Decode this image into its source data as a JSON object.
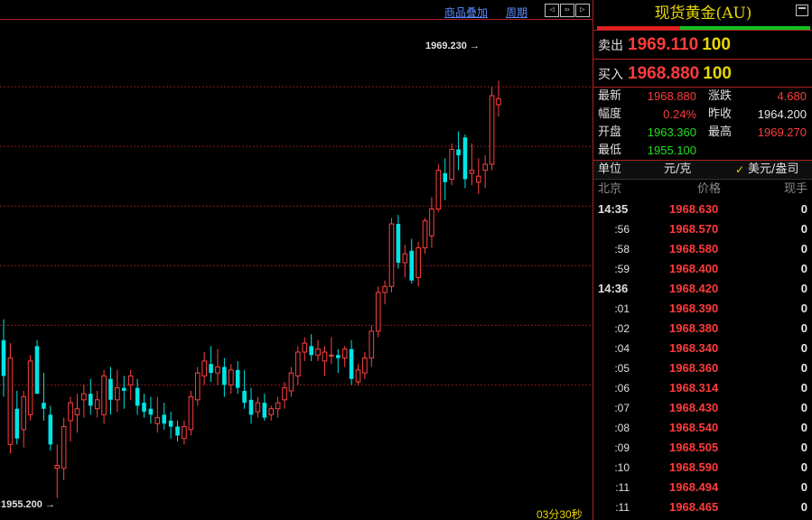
{
  "toolbar": {
    "overlay_link": "商品叠加",
    "period_link": "周期"
  },
  "chart": {
    "high_label": "1969.230",
    "low_label": "1955.200",
    "timer": "03分30秒",
    "colors": {
      "up": "#ff4040",
      "down": "#00e5e5",
      "grid": "#8a1a1a",
      "border": "#b02020"
    }
  },
  "chart_data": {
    "type": "candlestick",
    "ylim": [
      1954.8,
      1970.7
    ],
    "grid_y": [
      1969.0,
      1967.0,
      1965.0,
      1963.0,
      1961.0,
      1959.0
    ],
    "candles": [
      {
        "o": 1960.5,
        "h": 1961.2,
        "l": 1958.6,
        "c": 1959.3
      },
      {
        "o": 1957.0,
        "h": 1960.4,
        "l": 1956.7,
        "c": 1959.9
      },
      {
        "o": 1958.2,
        "h": 1958.8,
        "l": 1957.0,
        "c": 1957.2
      },
      {
        "o": 1957.5,
        "h": 1958.8,
        "l": 1956.9,
        "c": 1958.6
      },
      {
        "o": 1958.0,
        "h": 1960.0,
        "l": 1957.8,
        "c": 1959.8
      },
      {
        "o": 1960.3,
        "h": 1960.5,
        "l": 1958.7,
        "c": 1958.7
      },
      {
        "o": 1958.4,
        "h": 1959.4,
        "l": 1957.8,
        "c": 1958.2
      },
      {
        "o": 1958.0,
        "h": 1958.3,
        "l": 1956.8,
        "c": 1957.0
      },
      {
        "o": 1956.2,
        "h": 1957.0,
        "l": 1955.2,
        "c": 1956.3
      },
      {
        "o": 1956.2,
        "h": 1957.9,
        "l": 1955.8,
        "c": 1957.6
      },
      {
        "o": 1957.8,
        "h": 1958.6,
        "l": 1957.1,
        "c": 1958.4
      },
      {
        "o": 1958.0,
        "h": 1958.7,
        "l": 1957.4,
        "c": 1958.2
      },
      {
        "o": 1958.5,
        "h": 1959.0,
        "l": 1957.9,
        "c": 1958.7
      },
      {
        "o": 1958.7,
        "h": 1959.2,
        "l": 1958.0,
        "c": 1958.3
      },
      {
        "o": 1958.2,
        "h": 1958.8,
        "l": 1957.9,
        "c": 1958.5
      },
      {
        "o": 1958.0,
        "h": 1959.5,
        "l": 1957.7,
        "c": 1959.3
      },
      {
        "o": 1959.2,
        "h": 1959.6,
        "l": 1958.0,
        "c": 1958.5
      },
      {
        "o": 1958.5,
        "h": 1959.5,
        "l": 1958.1,
        "c": 1958.9
      },
      {
        "o": 1958.9,
        "h": 1959.3,
        "l": 1958.2,
        "c": 1958.8
      },
      {
        "o": 1959.0,
        "h": 1959.5,
        "l": 1958.5,
        "c": 1959.3
      },
      {
        "o": 1958.9,
        "h": 1959.2,
        "l": 1958.0,
        "c": 1958.3
      },
      {
        "o": 1958.4,
        "h": 1958.7,
        "l": 1957.9,
        "c": 1958.1
      },
      {
        "o": 1958.2,
        "h": 1958.6,
        "l": 1957.7,
        "c": 1958.0
      },
      {
        "o": 1957.7,
        "h": 1958.6,
        "l": 1957.4,
        "c": 1957.9
      },
      {
        "o": 1958.0,
        "h": 1958.4,
        "l": 1957.5,
        "c": 1957.7
      },
      {
        "o": 1957.8,
        "h": 1958.1,
        "l": 1957.2,
        "c": 1957.6
      },
      {
        "o": 1957.6,
        "h": 1957.8,
        "l": 1957.1,
        "c": 1957.3
      },
      {
        "o": 1957.2,
        "h": 1957.8,
        "l": 1957.0,
        "c": 1957.6
      },
      {
        "o": 1957.5,
        "h": 1958.8,
        "l": 1957.3,
        "c": 1958.6
      },
      {
        "o": 1958.5,
        "h": 1959.6,
        "l": 1958.3,
        "c": 1959.4
      },
      {
        "o": 1959.3,
        "h": 1960.1,
        "l": 1959.0,
        "c": 1959.8
      },
      {
        "o": 1959.7,
        "h": 1960.3,
        "l": 1959.1,
        "c": 1959.4
      },
      {
        "o": 1959.4,
        "h": 1960.2,
        "l": 1959.0,
        "c": 1959.6
      },
      {
        "o": 1959.6,
        "h": 1959.9,
        "l": 1958.6,
        "c": 1959.0
      },
      {
        "o": 1959.0,
        "h": 1959.7,
        "l": 1958.7,
        "c": 1959.5
      },
      {
        "o": 1959.5,
        "h": 1959.8,
        "l": 1958.7,
        "c": 1958.9
      },
      {
        "o": 1958.8,
        "h": 1959.5,
        "l": 1958.2,
        "c": 1958.4
      },
      {
        "o": 1958.5,
        "h": 1958.9,
        "l": 1957.7,
        "c": 1958.0
      },
      {
        "o": 1958.1,
        "h": 1958.6,
        "l": 1957.9,
        "c": 1958.4
      },
      {
        "o": 1958.4,
        "h": 1958.7,
        "l": 1957.8,
        "c": 1957.9
      },
      {
        "o": 1958.0,
        "h": 1958.3,
        "l": 1957.8,
        "c": 1958.2
      },
      {
        "o": 1958.2,
        "h": 1958.6,
        "l": 1957.9,
        "c": 1958.4
      },
      {
        "o": 1958.5,
        "h": 1959.1,
        "l": 1958.2,
        "c": 1958.9
      },
      {
        "o": 1958.8,
        "h": 1959.6,
        "l": 1958.6,
        "c": 1959.4
      },
      {
        "o": 1959.3,
        "h": 1960.3,
        "l": 1959.0,
        "c": 1960.1
      },
      {
        "o": 1960.1,
        "h": 1960.6,
        "l": 1959.8,
        "c": 1960.4
      },
      {
        "o": 1960.3,
        "h": 1960.7,
        "l": 1959.8,
        "c": 1960.0
      },
      {
        "o": 1960.0,
        "h": 1960.5,
        "l": 1959.8,
        "c": 1960.2
      },
      {
        "o": 1959.8,
        "h": 1960.3,
        "l": 1959.3,
        "c": 1960.1
      },
      {
        "o": 1960.0,
        "h": 1960.6,
        "l": 1959.7,
        "c": 1960.0
      },
      {
        "o": 1960.0,
        "h": 1960.2,
        "l": 1959.4,
        "c": 1959.9
      },
      {
        "o": 1959.9,
        "h": 1960.3,
        "l": 1959.6,
        "c": 1960.2
      },
      {
        "o": 1960.2,
        "h": 1960.5,
        "l": 1959.0,
        "c": 1959.2
      },
      {
        "o": 1959.1,
        "h": 1959.7,
        "l": 1959.0,
        "c": 1959.5
      },
      {
        "o": 1959.4,
        "h": 1960.1,
        "l": 1959.2,
        "c": 1959.9
      },
      {
        "o": 1959.9,
        "h": 1961.0,
        "l": 1959.6,
        "c": 1960.8
      },
      {
        "o": 1960.8,
        "h": 1962.3,
        "l": 1960.6,
        "c": 1962.1
      },
      {
        "o": 1962.1,
        "h": 1962.5,
        "l": 1961.7,
        "c": 1962.3
      },
      {
        "o": 1962.3,
        "h": 1964.6,
        "l": 1962.1,
        "c": 1964.4
      },
      {
        "o": 1964.4,
        "h": 1964.7,
        "l": 1962.9,
        "c": 1963.1
      },
      {
        "o": 1963.1,
        "h": 1963.7,
        "l": 1962.6,
        "c": 1963.4
      },
      {
        "o": 1963.5,
        "h": 1963.9,
        "l": 1962.4,
        "c": 1962.5
      },
      {
        "o": 1962.6,
        "h": 1963.8,
        "l": 1962.3,
        "c": 1963.6
      },
      {
        "o": 1963.6,
        "h": 1964.6,
        "l": 1963.4,
        "c": 1964.5
      },
      {
        "o": 1964.0,
        "h": 1965.3,
        "l": 1963.6,
        "c": 1964.9
      },
      {
        "o": 1964.9,
        "h": 1966.4,
        "l": 1964.8,
        "c": 1966.2
      },
      {
        "o": 1966.1,
        "h": 1966.6,
        "l": 1965.2,
        "c": 1965.8
      },
      {
        "o": 1965.9,
        "h": 1967.1,
        "l": 1965.7,
        "c": 1966.9
      },
      {
        "o": 1966.9,
        "h": 1967.5,
        "l": 1966.2,
        "c": 1966.7
      },
      {
        "o": 1967.3,
        "h": 1967.4,
        "l": 1965.6,
        "c": 1965.9
      },
      {
        "o": 1966.1,
        "h": 1967.1,
        "l": 1965.7,
        "c": 1966.2
      },
      {
        "o": 1965.8,
        "h": 1966.6,
        "l": 1965.4,
        "c": 1966.0
      },
      {
        "o": 1966.2,
        "h": 1966.7,
        "l": 1965.6,
        "c": 1966.4
      },
      {
        "o": 1966.4,
        "h": 1969.0,
        "l": 1966.2,
        "c": 1968.7
      },
      {
        "o": 1968.4,
        "h": 1969.2,
        "l": 1968.0,
        "c": 1968.6
      }
    ]
  },
  "quote": {
    "title": "现货黄金(AU)",
    "sell_label": "卖出",
    "sell_price": "1969.110",
    "sell_vol": "100",
    "buy_label": "买入",
    "buy_price": "1968.880",
    "buy_vol": "100",
    "stats": {
      "latest_label": "最新",
      "latest": "1968.880",
      "change_label": "涨跌",
      "change": "4.680",
      "range_label": "幅度",
      "range": "0.24%",
      "prev_close_label": "昨收",
      "prev_close": "1964.200",
      "open_label": "开盘",
      "open": "1963.360",
      "high_label": "最高",
      "high": "1969.270",
      "low_label": "最低",
      "low": "1955.100"
    },
    "unit": {
      "label": "单位",
      "cny": "元/克",
      "check": "✓",
      "usd": "美元/盎司"
    },
    "ticks_header": {
      "col1": "北京",
      "col2": "价格",
      "col3": "现手"
    },
    "ticks": [
      {
        "time": "14:35",
        "price": "1968.630",
        "vol": "0",
        "major": true
      },
      {
        "time": ":56",
        "price": "1968.570",
        "vol": "0"
      },
      {
        "time": ":58",
        "price": "1968.580",
        "vol": "0"
      },
      {
        "time": ":59",
        "price": "1968.400",
        "vol": "0"
      },
      {
        "time": "14:36",
        "price": "1968.420",
        "vol": "0",
        "major": true
      },
      {
        "time": ":01",
        "price": "1968.390",
        "vol": "0"
      },
      {
        "time": ":02",
        "price": "1968.380",
        "vol": "0"
      },
      {
        "time": ":04",
        "price": "1968.340",
        "vol": "0"
      },
      {
        "time": ":05",
        "price": "1968.360",
        "vol": "0"
      },
      {
        "time": ":06",
        "price": "1968.314",
        "vol": "0"
      },
      {
        "time": ":07",
        "price": "1968.430",
        "vol": "0"
      },
      {
        "time": ":08",
        "price": "1968.540",
        "vol": "0"
      },
      {
        "time": ":09",
        "price": "1968.505",
        "vol": "0"
      },
      {
        "time": ":10",
        "price": "1968.590",
        "vol": "0"
      },
      {
        "time": ":11",
        "price": "1968.494",
        "vol": "0"
      },
      {
        "time": ":11",
        "price": "1968.465",
        "vol": "0"
      }
    ]
  }
}
